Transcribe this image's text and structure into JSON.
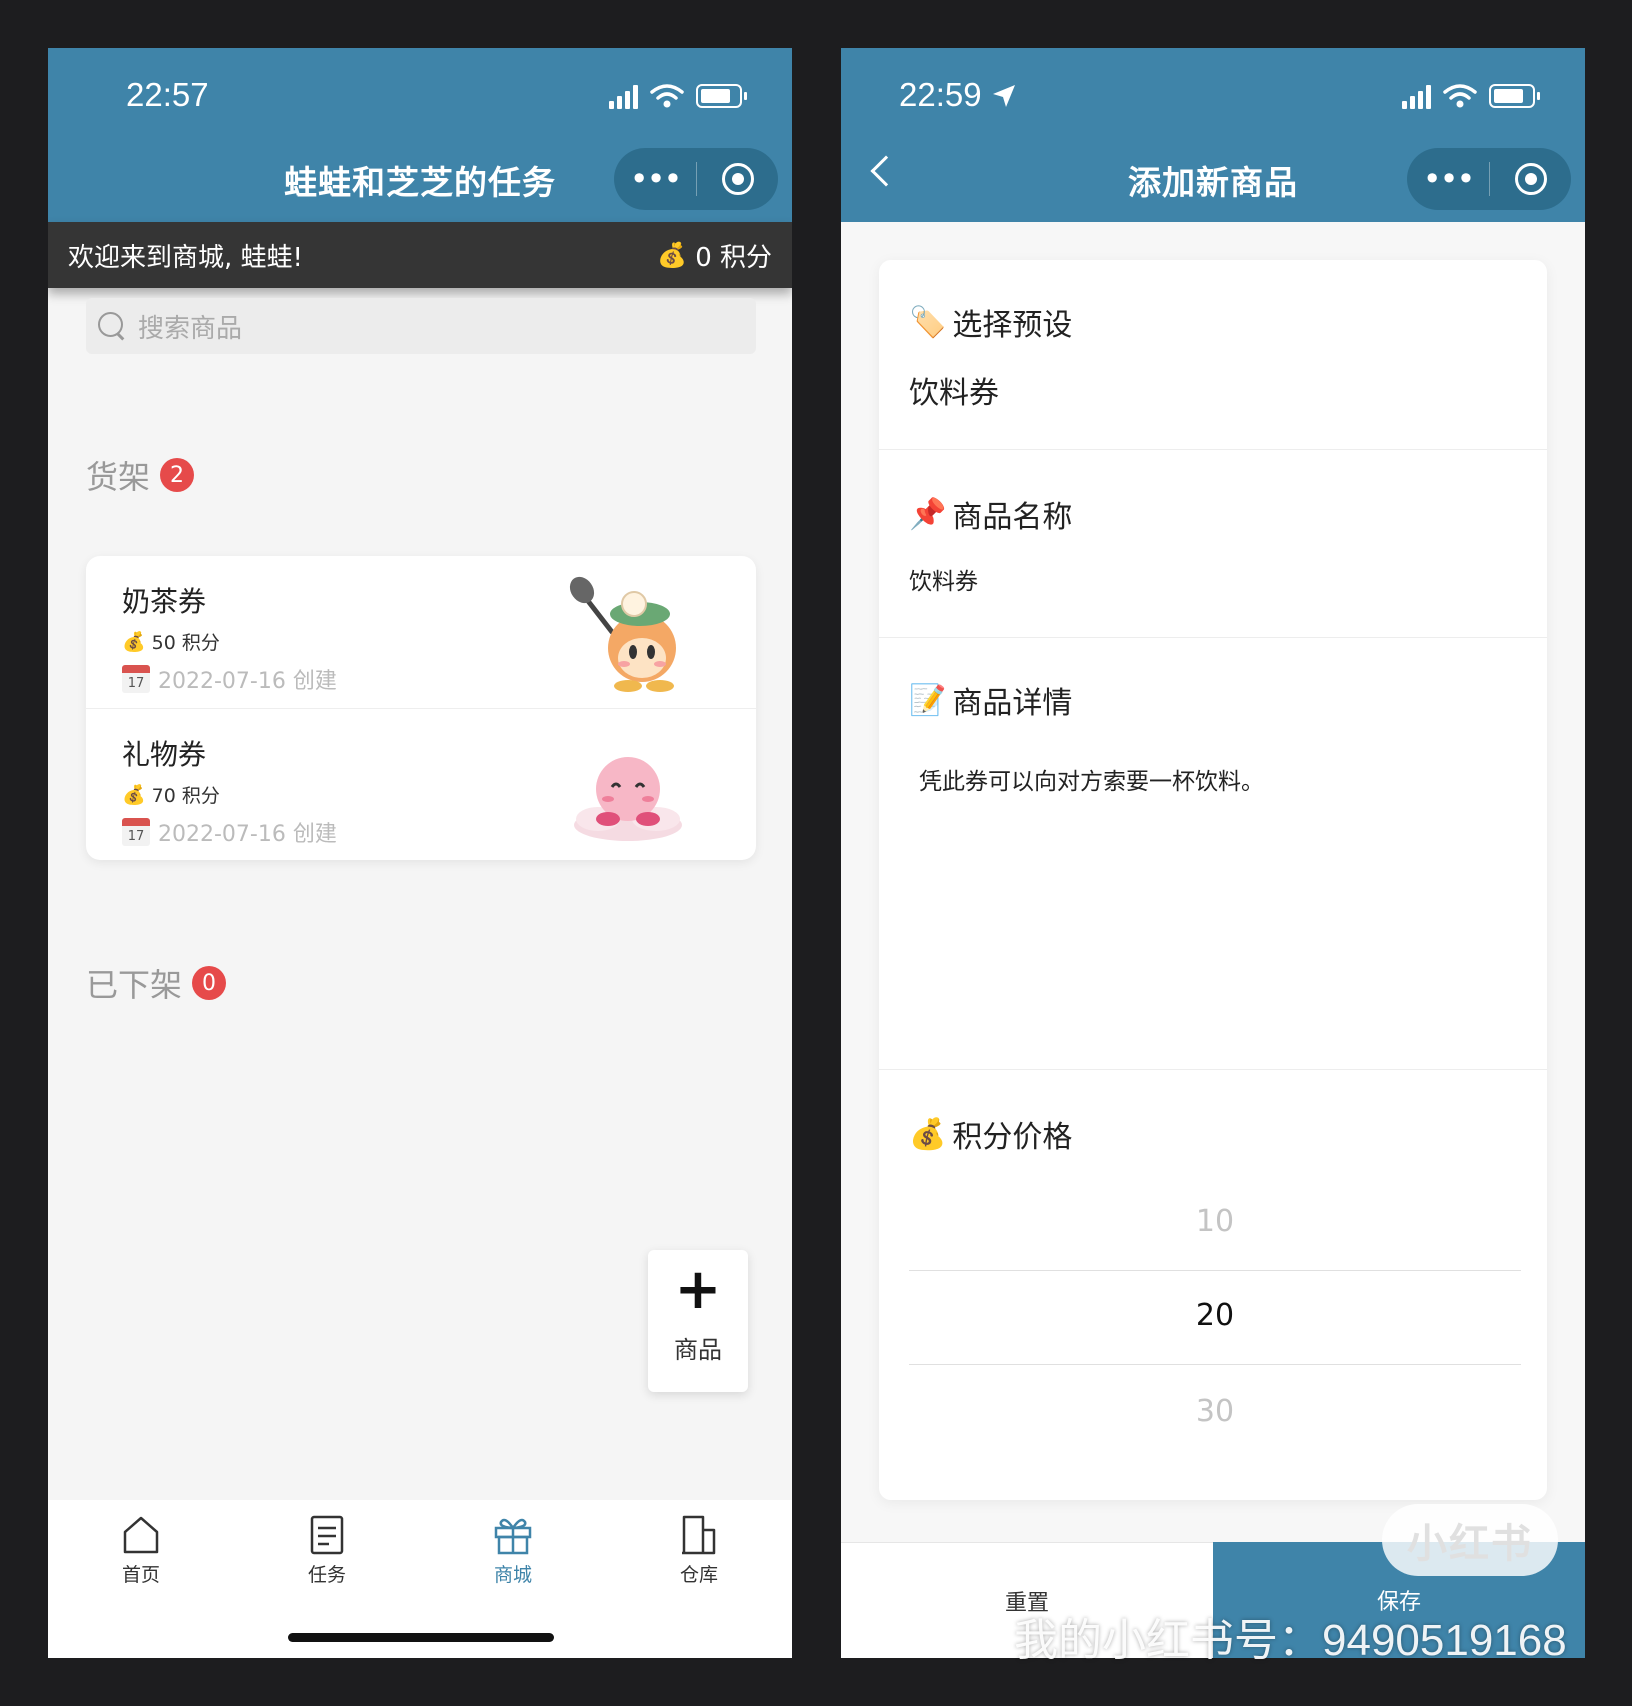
{
  "left": {
    "status": {
      "time": "22:57"
    },
    "nav": {
      "title": "蛙蛙和芝芝的任务",
      "more": "•••"
    },
    "welcome": {
      "text": "欢迎来到商城, 蛙蛙!",
      "points": "0 积分"
    },
    "search": {
      "placeholder": "搜索商品"
    },
    "shelf": {
      "label": "货架",
      "count": "2",
      "items": [
        {
          "name": "奶茶券",
          "points": "50 积分",
          "date": "2022-07-16 创建"
        },
        {
          "name": "礼物券",
          "points": "70 积分",
          "date": "2022-07-16 创建"
        }
      ]
    },
    "offshelf": {
      "label": "已下架",
      "count": "0"
    },
    "fab": {
      "icon": "+",
      "label": "商品"
    },
    "tabs": [
      {
        "label": "首页",
        "icon": "home-icon"
      },
      {
        "label": "任务",
        "icon": "task-icon"
      },
      {
        "label": "商城",
        "icon": "gift-icon",
        "active": true
      },
      {
        "label": "仓库",
        "icon": "warehouse-icon"
      }
    ],
    "calendar_day": "17"
  },
  "right": {
    "status": {
      "time": "22:59"
    },
    "nav": {
      "title": "添加新商品",
      "more": "•••"
    },
    "form": {
      "preset": {
        "label": "选择预设",
        "value": "饮料券"
      },
      "name": {
        "label": "商品名称",
        "value": "饮料券"
      },
      "detail": {
        "label": "商品详情",
        "value": "凭此券可以向对方索要一杯饮料。"
      },
      "price": {
        "label": "积分价格",
        "options": [
          "10",
          "20",
          "30"
        ],
        "selected": "20"
      }
    },
    "buttons": {
      "reset": "重置",
      "save": "保存"
    }
  },
  "watermark": {
    "logo": "小红书",
    "text": "我的小红书号：9490519168"
  },
  "colors": {
    "brand": "#3f84a9",
    "dark_bar": "#353535",
    "badge": "#e64a4a"
  }
}
